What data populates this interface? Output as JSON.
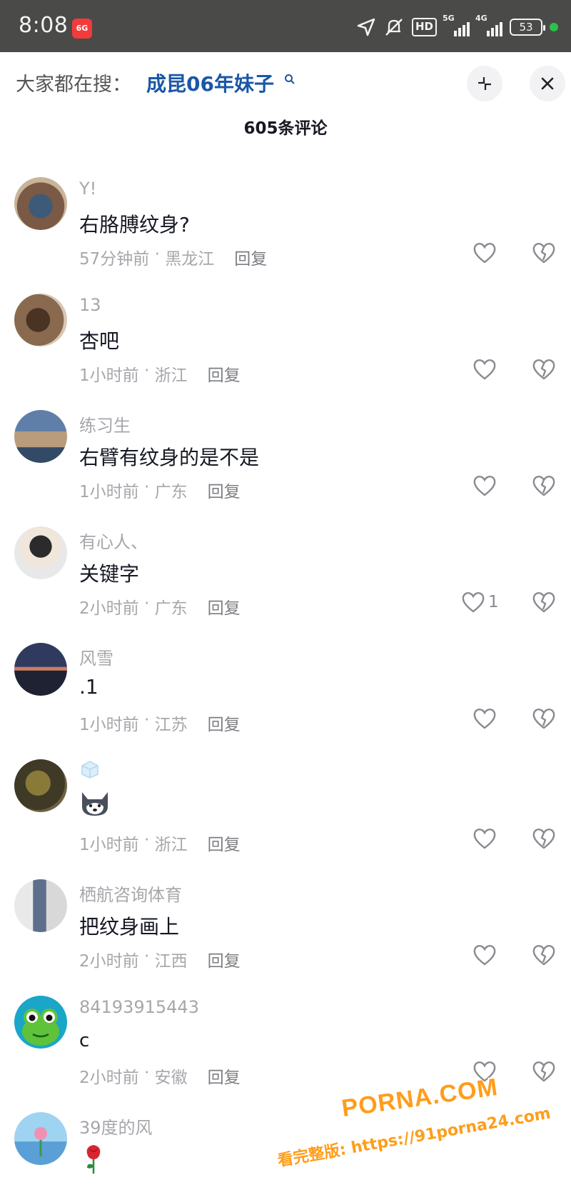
{
  "status_bar": {
    "time": "8:08",
    "app_badge": "6G",
    "hd": "HD",
    "net1": "5G",
    "net2": "4G",
    "battery": "53"
  },
  "search": {
    "prefix": "大家都在搜：",
    "term": "成昆06年妹子"
  },
  "comment_count": "605条评论",
  "colors": {
    "accent": "#1a57a6",
    "meta": "#a6a7ab",
    "watermark": "#ff9d1a"
  },
  "comments": [
    {
      "user": "Y!",
      "text": "右胳膊纹身?",
      "time": "57分钟前",
      "location": "黑龙江",
      "reply": "回复",
      "likes": ""
    },
    {
      "user": "13",
      "text": "杏吧",
      "time": "1小时前",
      "location": "浙江",
      "reply": "回复",
      "likes": ""
    },
    {
      "user": "练习生",
      "text": "右臂有纹身的是不是",
      "time": "1小时前",
      "location": "广东",
      "reply": "回复",
      "likes": ""
    },
    {
      "user": "有心人、",
      "text": "关键字",
      "time": "2小时前",
      "location": "广东",
      "reply": "回复",
      "likes": "1"
    },
    {
      "user": "风雪",
      "text": ".1",
      "time": "1小时前",
      "location": "江苏",
      "reply": "回复",
      "likes": ""
    },
    {
      "user": "",
      "text": "",
      "time": "1小时前",
      "location": "浙江",
      "reply": "回复",
      "likes": ""
    },
    {
      "user": "栖航咨询体育",
      "text": "把纹身画上",
      "time": "2小时前",
      "location": "江西",
      "reply": "回复",
      "likes": ""
    },
    {
      "user": "84193915443",
      "text": "c",
      "time": "2小时前",
      "location": "安徽",
      "reply": "回复",
      "likes": ""
    },
    {
      "user": "39度的风",
      "text": "",
      "time": "",
      "location": "",
      "reply": "",
      "likes": ""
    }
  ],
  "watermark": {
    "brand": "PORNA.COM",
    "line": "看完整版: https://91porna24.com"
  }
}
